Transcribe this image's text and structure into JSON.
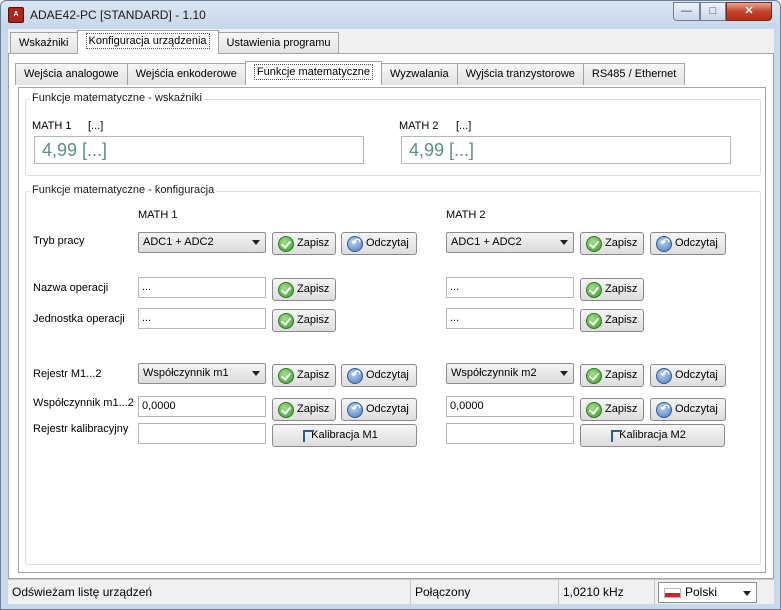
{
  "window": {
    "title": "ADAE42-PC [STANDARD] - 1.10",
    "min": "—",
    "max": "□",
    "close": "✕"
  },
  "main_tabs": [
    "Wskaźniki",
    "Konfiguracja urządzenia",
    "Ustawienia programu"
  ],
  "sub_tabs": [
    "Wejścia analogowe",
    "Wejścia enkoderowe",
    "Funkcje matematyczne",
    "Wyzwalania",
    "Wyjścia tranzystorowe",
    "RS485 / Ethernet"
  ],
  "indicators": {
    "title": "Funkcje matematyczne - wskaźniki",
    "math1_label": "MATH 1",
    "math1_unit": "[...]",
    "math1_value": "4,99 [...]",
    "math2_label": "MATH 2",
    "math2_unit": "[...]",
    "math2_value": "4,99 [...]"
  },
  "config": {
    "title": "Funkcje matematyczne - konfiguracja",
    "col1": "MATH 1",
    "col2": "MATH 2",
    "row_tryb": "Tryb pracy",
    "row_nazwa": "Nazwa operacji",
    "row_jednostka": "Jednostka operacji",
    "row_rejestr": "Rejestr M1...2",
    "row_wspolczynnik": "Współczynnik m1...2",
    "row_kalibracja": "Rejestr kalibracyjny",
    "m1": {
      "tryb": "ADC1 + ADC2",
      "nazwa": "...",
      "jednostka": "...",
      "rejestr": "Współczynnik m1",
      "wspolczynnik": "0,0000",
      "kalibracja": "",
      "kal_button": "Kalibracja M1"
    },
    "m2": {
      "tryb": "ADC1 + ADC2",
      "nazwa": "...",
      "jednostka": "...",
      "rejestr": "Współczynnik m2",
      "wspolczynnik": "0,0000",
      "kalibracja": "",
      "kal_button": "Kalibracja M2"
    },
    "save_label": "Zapisz",
    "read_label": "Odczytaj"
  },
  "status": {
    "message": "Odświeżam listę urządzeń",
    "connection": "Połączony",
    "frequency": "1,0210 kHz",
    "language": "Polski"
  }
}
